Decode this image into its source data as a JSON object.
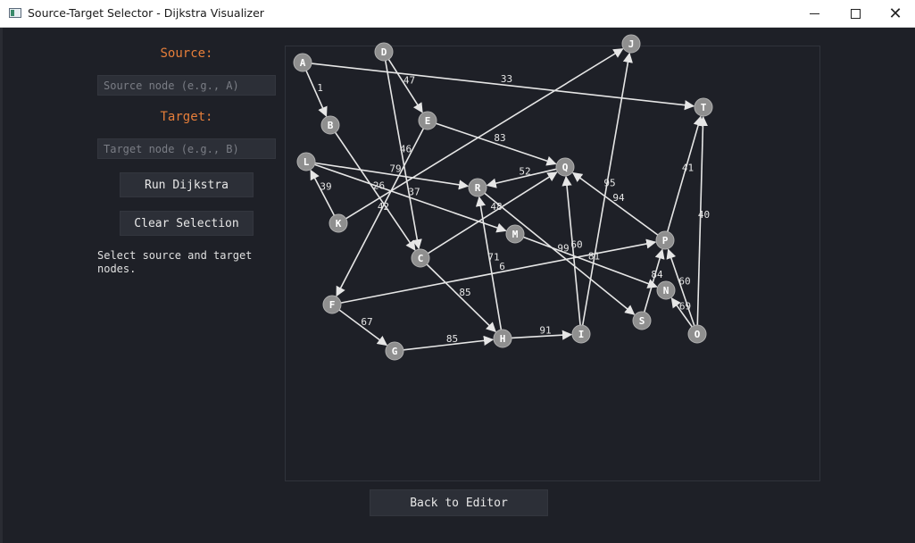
{
  "window": {
    "title": "Source-Target Selector - Dijkstra Visualizer"
  },
  "panel": {
    "source_label": "Source:",
    "source_placeholder": "Source node (e.g., A)",
    "target_label": "Target:",
    "target_placeholder": "Target node (e.g., B)",
    "run_button": "Run Dijkstra",
    "clear_button": "Clear Selection",
    "status": "Select source and target nodes."
  },
  "footer": {
    "back_button": "Back to Editor"
  },
  "colors": {
    "accent": "#e67e3a",
    "background": "#1e2027",
    "node_fill": "#8f8f8f",
    "edge": "#e6e6e6"
  },
  "graph": {
    "nodes": [
      "A",
      "B",
      "C",
      "D",
      "E",
      "F",
      "G",
      "H",
      "I",
      "J",
      "K",
      "L",
      "M",
      "N",
      "O",
      "P",
      "Q",
      "R",
      "S",
      "T"
    ],
    "edges": [
      {
        "from": "A",
        "to": "B",
        "weight": "1"
      },
      {
        "from": "A",
        "to": "T",
        "weight": "33"
      },
      {
        "from": "D",
        "to": "E",
        "weight": "47"
      },
      {
        "from": "D",
        "to": "C",
        "weight": "46"
      },
      {
        "from": "E",
        "to": "Q",
        "weight": "83"
      },
      {
        "from": "E",
        "to": "F",
        "weight": "42"
      },
      {
        "from": "B",
        "to": "C",
        "weight": "26"
      },
      {
        "from": "L",
        "to": "R",
        "weight": "79"
      },
      {
        "from": "L",
        "to": "M",
        "weight": "37"
      },
      {
        "from": "K",
        "to": "L",
        "weight": "39"
      },
      {
        "from": "K",
        "to": "J",
        "weight": ""
      },
      {
        "from": "Q",
        "to": "R",
        "weight": "52"
      },
      {
        "from": "C",
        "to": "Q",
        "weight": "48"
      },
      {
        "from": "C",
        "to": "H",
        "weight": "85"
      },
      {
        "from": "R",
        "to": "S",
        "weight": "99"
      },
      {
        "from": "H",
        "to": "R",
        "weight": "71"
      },
      {
        "from": "M",
        "to": "N",
        "weight": "81"
      },
      {
        "from": "F",
        "to": "P",
        "weight": "6"
      },
      {
        "from": "F",
        "to": "G",
        "weight": "67"
      },
      {
        "from": "G",
        "to": "H",
        "weight": "85"
      },
      {
        "from": "H",
        "to": "I",
        "weight": "91"
      },
      {
        "from": "I",
        "to": "Q",
        "weight": "60"
      },
      {
        "from": "I",
        "to": "J",
        "weight": "95"
      },
      {
        "from": "P",
        "to": "Q",
        "weight": "94"
      },
      {
        "from": "P",
        "to": "T",
        "weight": "41"
      },
      {
        "from": "S",
        "to": "P",
        "weight": "84"
      },
      {
        "from": "O",
        "to": "T",
        "weight": "40"
      },
      {
        "from": "O",
        "to": "N",
        "weight": "69"
      },
      {
        "from": "O",
        "to": "P",
        "weight": "60"
      }
    ]
  }
}
